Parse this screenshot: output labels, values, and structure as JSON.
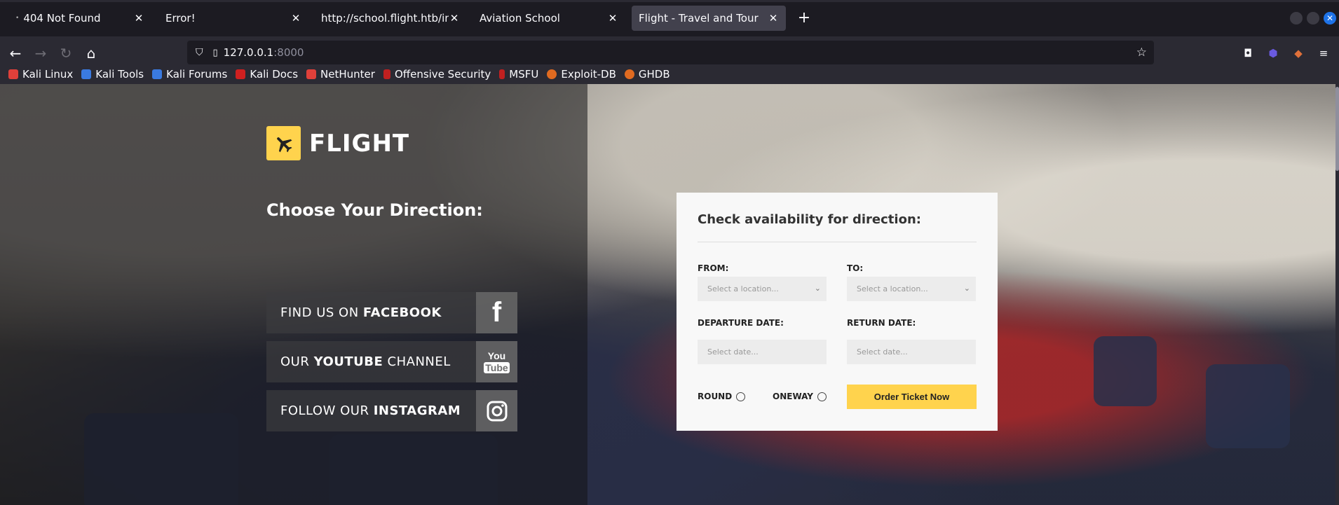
{
  "browser": {
    "tabs": [
      {
        "title": "404 Not Found",
        "active": false
      },
      {
        "title": "Error!",
        "active": false
      },
      {
        "title": "http://school.flight.htb/index",
        "active": false
      },
      {
        "title": "Aviation School",
        "active": false
      },
      {
        "title": "Flight - Travel and Tour",
        "active": true
      }
    ],
    "url_host": "127.0.0.1",
    "url_port": ":8000",
    "bookmarks": [
      {
        "label": "Kali Linux",
        "color": "#e0403a"
      },
      {
        "label": "Kali Tools",
        "color": "#3a7ae0"
      },
      {
        "label": "Kali Forums",
        "color": "#3a7ae0"
      },
      {
        "label": "Kali Docs",
        "color": "#d02020"
      },
      {
        "label": "NetHunter",
        "color": "#e0403a"
      },
      {
        "label": "Offensive Security",
        "color": "#c02020"
      },
      {
        "label": "MSFU",
        "color": "#c02020"
      },
      {
        "label": "Exploit-DB",
        "color": "#e06a20"
      },
      {
        "label": "GHDB",
        "color": "#e06a20"
      }
    ]
  },
  "site": {
    "logo": "FLIGHT",
    "choose_heading": "Choose Your Direction:",
    "social": [
      {
        "pre": "FIND US ON ",
        "bold": "FACEBOOK",
        "post": ""
      },
      {
        "pre": "OUR ",
        "bold": "YOUTUBE",
        "post": " CHANNEL"
      },
      {
        "pre": "FOLLOW OUR ",
        "bold": "INSTAGRAM",
        "post": ""
      }
    ],
    "youtube_icon_text": [
      "You",
      "Tube"
    ],
    "form": {
      "heading": "Check availability for direction:",
      "from_label": "FROM:",
      "to_label": "TO:",
      "location_placeholder": "Select a location...",
      "departure_label": "DEPARTURE DATE:",
      "return_label": "RETURN DATE:",
      "date_placeholder": "Select date...",
      "round_label": "ROUND",
      "oneway_label": "ONEWAY",
      "order_button": "Order Ticket Now"
    }
  },
  "colors": {
    "accent": "#ffd34d",
    "browser_bg": "#1c1b22",
    "toolbar_bg": "#2b2a33"
  }
}
